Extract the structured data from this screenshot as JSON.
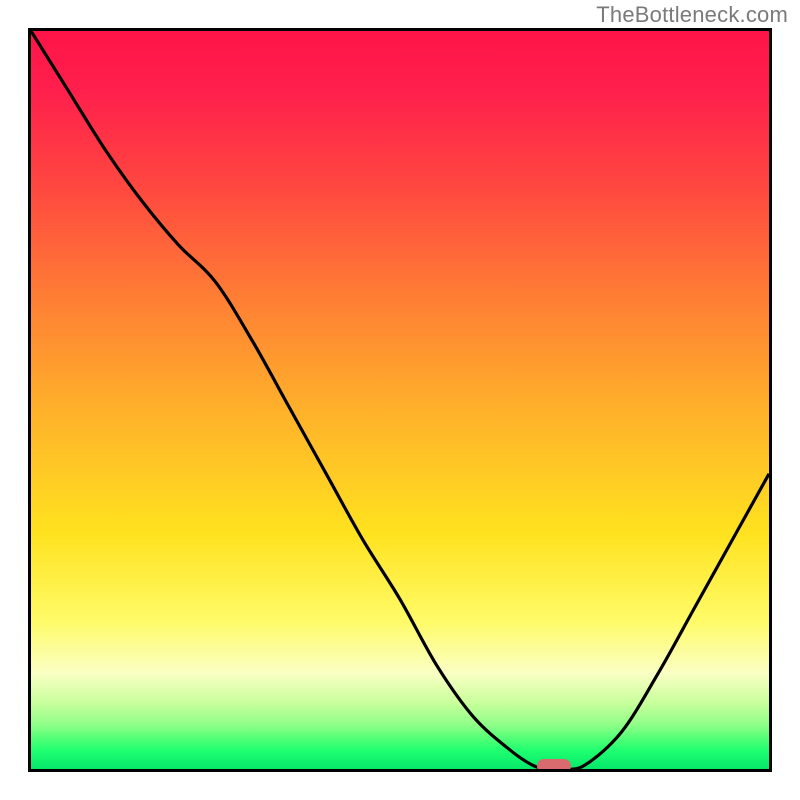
{
  "watermark": "TheBottleneck.com",
  "colors": {
    "border": "#000000",
    "curve": "#000000",
    "marker": "#d96b6e",
    "watermark_text": "#7a7a7a",
    "gradient_top": "#ff1448",
    "gradient_mid1": "#ff7a35",
    "gradient_mid2": "#ffe21f",
    "gradient_bottom": "#07e86b"
  },
  "chart_data": {
    "type": "line",
    "title": "",
    "xlabel": "",
    "ylabel": "",
    "xlim": [
      0,
      100
    ],
    "ylim": [
      0,
      100
    ],
    "grid": false,
    "legend": false,
    "x": [
      0,
      5,
      10,
      15,
      20,
      25,
      30,
      35,
      40,
      45,
      50,
      55,
      60,
      65,
      68,
      70,
      72,
      75,
      80,
      85,
      90,
      95,
      100
    ],
    "values": [
      100,
      92,
      84,
      77,
      71,
      66,
      58,
      49,
      40,
      31,
      23,
      14,
      7,
      2.5,
      0.5,
      0,
      0,
      0.5,
      5,
      13,
      22,
      31,
      40
    ],
    "series": [
      {
        "name": "bottleneck-curve",
        "values": [
          100,
          92,
          84,
          77,
          71,
          66,
          58,
          49,
          40,
          31,
          23,
          14,
          7,
          2.5,
          0.5,
          0,
          0,
          0.5,
          5,
          13,
          22,
          31,
          40
        ]
      }
    ],
    "marker": {
      "x": 71,
      "y": 0,
      "width_pct": 4.6,
      "height_pct": 1.8
    },
    "annotations": []
  }
}
